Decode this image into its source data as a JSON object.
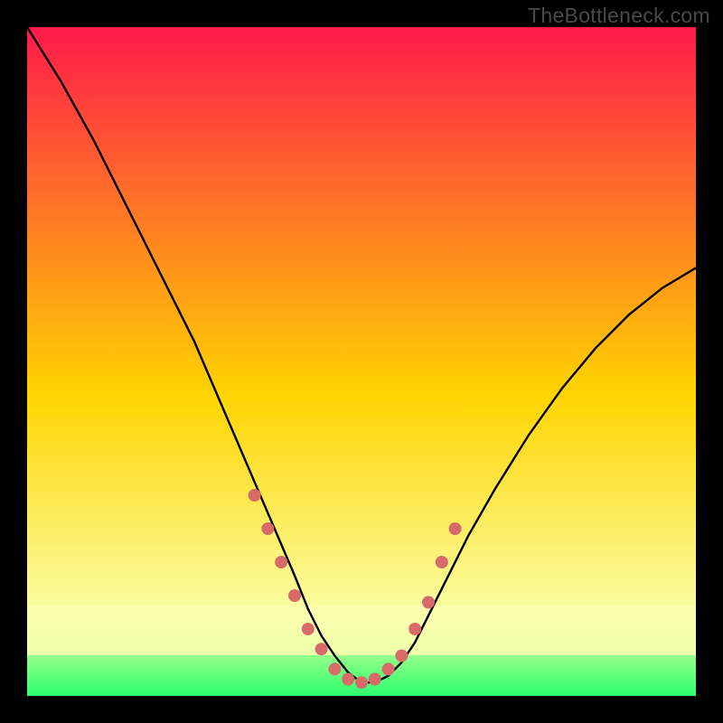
{
  "watermark": "TheBottleneck.com",
  "colors": {
    "gradient_top": "#ff1a4a",
    "gradient_mid": "#ffd400",
    "gradient_bottom_band": "#faffa6",
    "gradient_bottom": "#2cff6e",
    "curve": "#000000",
    "points": "#d86a6a",
    "frame": "#000000"
  },
  "chart_data": {
    "type": "line",
    "title": "",
    "xlabel": "",
    "ylabel": "",
    "xlim": [
      0,
      100
    ],
    "ylim": [
      0,
      100
    ],
    "curve": {
      "name": "bottleneck-curve",
      "x": [
        0,
        5,
        10,
        15,
        20,
        25,
        28,
        31,
        34,
        37,
        40,
        42,
        44,
        46,
        48,
        50,
        52,
        54,
        56,
        58,
        60,
        63,
        66,
        70,
        75,
        80,
        85,
        90,
        95,
        100
      ],
      "y": [
        100,
        92,
        83,
        73,
        63,
        53,
        46,
        39,
        32,
        25,
        18,
        13,
        9,
        6,
        3.5,
        2,
        2,
        3,
        5,
        8,
        12,
        18,
        24,
        31,
        39,
        46,
        52,
        57,
        61,
        64
      ]
    },
    "points": {
      "name": "sample-points",
      "x": [
        34,
        36,
        38,
        40,
        42,
        44,
        46,
        48,
        50,
        52,
        54,
        56,
        58,
        60,
        62,
        64
      ],
      "y": [
        30,
        25,
        20,
        15,
        10,
        7,
        4,
        2.5,
        2,
        2.5,
        4,
        6,
        10,
        14,
        20,
        25
      ]
    }
  }
}
